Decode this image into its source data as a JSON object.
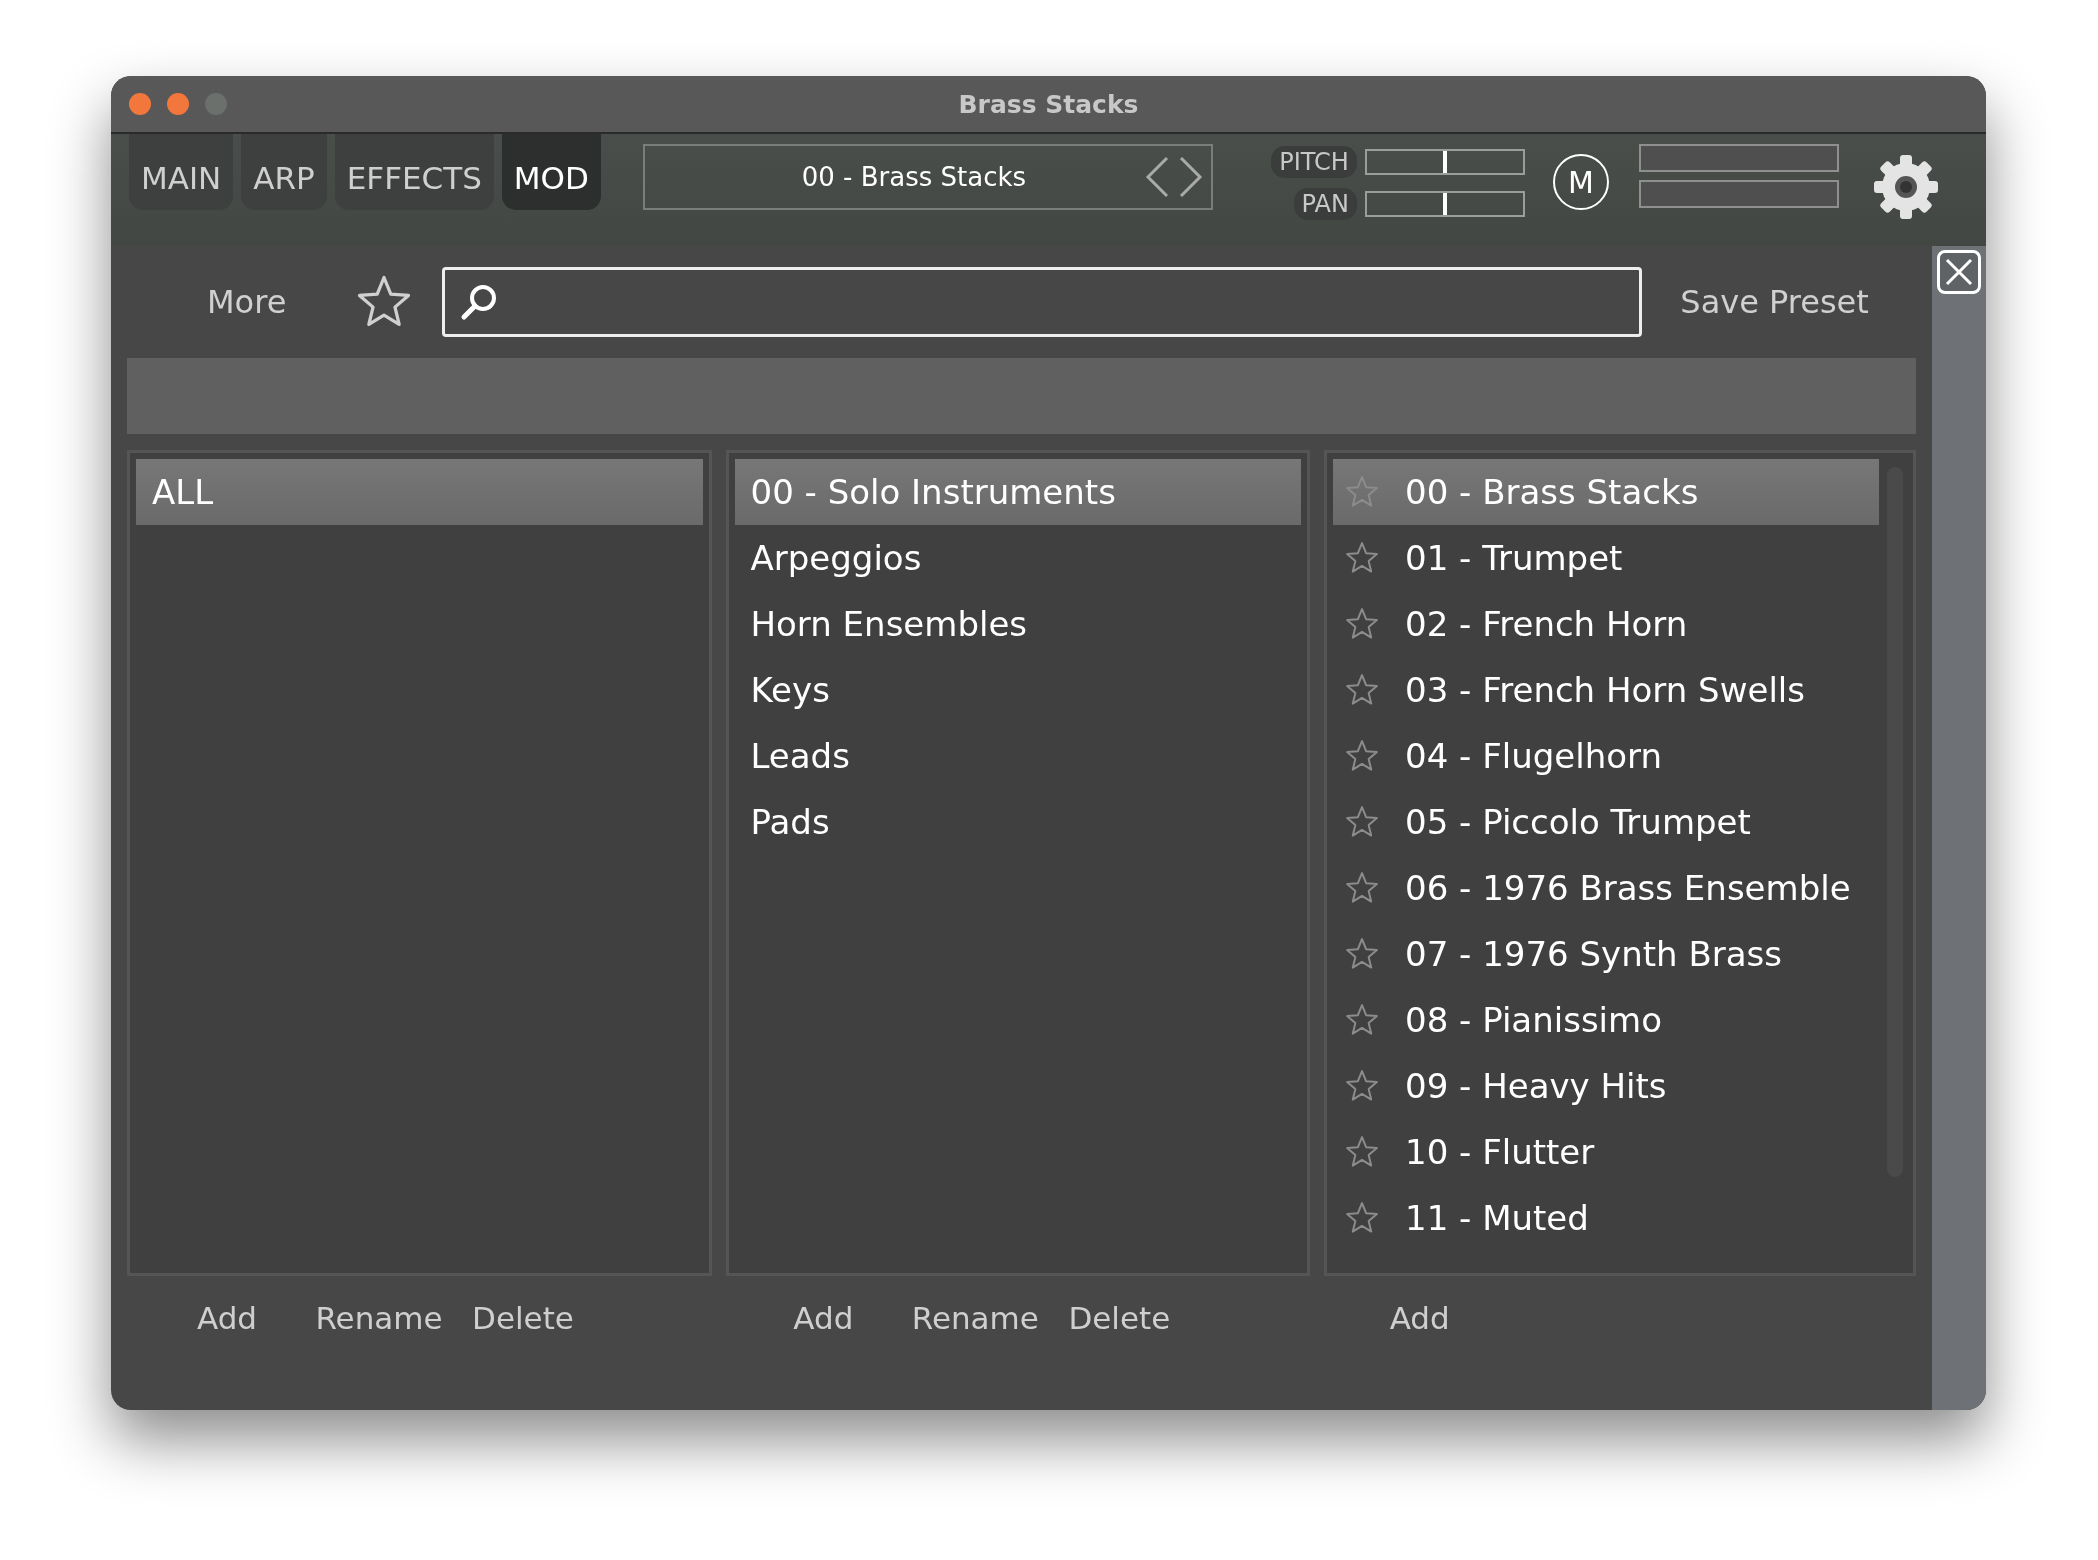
{
  "window": {
    "title": "Brass Stacks"
  },
  "tabs": [
    {
      "label": "MAIN",
      "selected": false
    },
    {
      "label": "ARP",
      "selected": false
    },
    {
      "label": "EFFECTS",
      "selected": false
    },
    {
      "label": "MOD",
      "selected": true
    }
  ],
  "preset_display": {
    "name": "00 - Brass Stacks"
  },
  "sliders": [
    {
      "label": "PITCH",
      "level": 0.5
    },
    {
      "label": "PAN",
      "level": 0.5
    }
  ],
  "mono_button": {
    "label": "M"
  },
  "browser": {
    "more": "More",
    "favorites_filter": false,
    "save": "Save Preset"
  },
  "categories": [
    {
      "items": [
        {
          "label": "ALL",
          "selected": true
        }
      ],
      "buttons": [
        "Add",
        "Rename",
        "Delete"
      ]
    },
    {
      "items": [
        {
          "label": "00 - Solo Instruments",
          "selected": true
        },
        {
          "label": "Arpeggios",
          "selected": false
        },
        {
          "label": "Horn Ensembles",
          "selected": false
        },
        {
          "label": "Keys",
          "selected": false
        },
        {
          "label": "Leads",
          "selected": false
        },
        {
          "label": "Pads",
          "selected": false
        }
      ],
      "buttons": [
        "Add",
        "Rename",
        "Delete"
      ]
    }
  ],
  "presets": {
    "items": [
      {
        "label": "00 - Brass Stacks",
        "selected": true,
        "favorite": false
      },
      {
        "label": "01 - Trumpet",
        "selected": false,
        "favorite": false
      },
      {
        "label": "02 - French Horn",
        "selected": false,
        "favorite": false
      },
      {
        "label": "03 - French Horn Swells",
        "selected": false,
        "favorite": false
      },
      {
        "label": "04 - Flugelhorn",
        "selected": false,
        "favorite": false
      },
      {
        "label": "05 - Piccolo Trumpet",
        "selected": false,
        "favorite": false
      },
      {
        "label": "06 - 1976 Brass Ensemble",
        "selected": false,
        "favorite": false
      },
      {
        "label": "07 - 1976 Synth Brass",
        "selected": false,
        "favorite": false
      },
      {
        "label": "08 - Pianissimo",
        "selected": false,
        "favorite": false
      },
      {
        "label": "09 - Heavy Hits",
        "selected": false,
        "favorite": false
      },
      {
        "label": "10 - Flutter",
        "selected": false,
        "favorite": false
      },
      {
        "label": "11 - Muted",
        "selected": false,
        "favorite": false
      }
    ],
    "buttons": [
      "Add"
    ]
  }
}
